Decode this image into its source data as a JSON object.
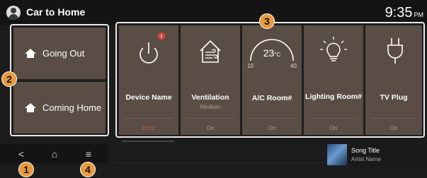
{
  "header": {
    "title": "Car to Home",
    "time": "9:35",
    "ampm": "PM"
  },
  "modes": [
    {
      "label": "Going Out"
    },
    {
      "label": "Coming Home"
    }
  ],
  "devices": [
    {
      "name": "Device Name",
      "sub": "",
      "status": "Error",
      "icon": "power-icon"
    },
    {
      "name": "Ventilation",
      "sub": "Medium",
      "status": "On",
      "icon": "ventilation-icon"
    },
    {
      "name": "A/C Room#",
      "sub": "",
      "status": "On",
      "icon": "ac-gauge-icon",
      "temperature": "23",
      "unit": "°C",
      "min": "10",
      "max": "40"
    },
    {
      "name": "Lighting Room#",
      "sub": "",
      "status": "On",
      "icon": "lightbulb-icon"
    },
    {
      "name": "TV Plug",
      "sub": "",
      "status": "On",
      "icon": "plug-icon"
    }
  ],
  "nav": {
    "back": "<",
    "home": "⌂",
    "menu": "≡"
  },
  "media": {
    "song": "Song Title",
    "artist": "Artist Name"
  },
  "markers": [
    "1",
    "2",
    "3",
    "4"
  ],
  "colors": {
    "card": "#5a4d45",
    "marker": "#e89a3c",
    "error": "#d25a4a"
  }
}
